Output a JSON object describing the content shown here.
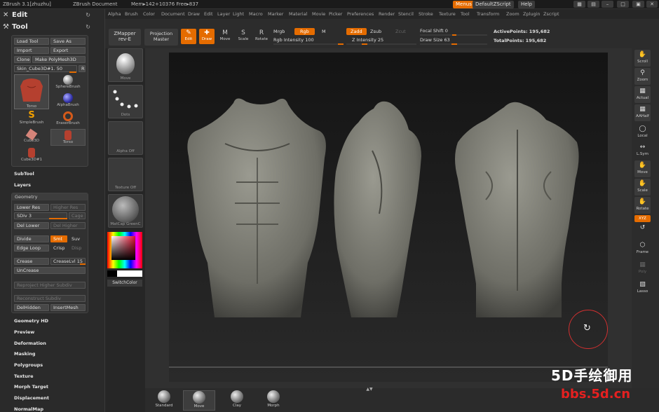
{
  "titlebar": {
    "app": "ZBrush 3.1[zhuzhu]",
    "doc": "ZBrush Document",
    "mem": "Mem▸142+10376 Free▸837",
    "menus": "Menus",
    "script": "DefaultZScript",
    "help": "Help"
  },
  "menubar": [
    "Alpha",
    "Brush",
    "Color",
    "Document",
    "Draw",
    "Edit",
    "Layer",
    "Light",
    "Macro",
    "Marker",
    "Material",
    "Movie",
    "Picker",
    "Preferences",
    "Render",
    "Stencil",
    "Stroke",
    "Texture",
    "Tool",
    "Transform",
    "Zoom",
    "Zplugin",
    "Zscript"
  ],
  "left": {
    "edit": "Edit",
    "tool": "Tool",
    "load_tool": "Load Tool",
    "save_as": "Save As",
    "import": "Import",
    "export": "Export",
    "clone": "Clone",
    "make_polymesh": "Make PolyMesh3D",
    "skin_slider": "Skin_Cube3D#1. 50",
    "r": "R",
    "thumbs": [
      "Torso",
      "SphereBrush",
      "AlphaBrush",
      "SimpleBrush",
      "EraserBrush",
      "Cube3D",
      "Torso",
      "Cube3D#1"
    ],
    "subtool": "SubTool",
    "layers": "Layers",
    "geometry": "Geometry",
    "lower_res": "Lower Res",
    "higher_res": "Higher Res",
    "sdiv": "SDiv 3",
    "cage": "Cage",
    "del_lower": "Del Lower",
    "del_higher": "Del Higher",
    "divide": "Divide",
    "smt": "Smt",
    "suv": "Suv",
    "edge_loop": "Edge Loop",
    "crisp": "Crisp",
    "disp": "Disp",
    "crease": "Crease",
    "creaselvl": "CreaseLvl 15",
    "uncrease": "UnCrease",
    "reproject": "Reproject Higher Subdiv",
    "reconstruct": "Reconstruct Subdiv",
    "delhidden": "DelHidden",
    "insertmesh": "InsertMesh",
    "sections": [
      "Geometry HD",
      "Preview",
      "Deformation",
      "Masking",
      "Polygroups",
      "Texture",
      "Morph Target",
      "Displacement",
      "NormalMap"
    ]
  },
  "toolbar": {
    "zmapper": "ZMapper",
    "zmapper2": "rev-E",
    "projection": "Projection",
    "projection2": "Master",
    "edit": "Edit",
    "draw": "Draw",
    "move": "Move",
    "scale": "Scale",
    "rotate": "Rotate",
    "mrgb": "Mrgb",
    "rgb": "Rgb",
    "m": "M",
    "rgb_intensity": "Rgb Intensity 100",
    "zadd": "Zadd",
    "zsub": "Zsub",
    "zcut": "Zcut",
    "z_intensity": "Z Intensity 25",
    "focal_shift": "Focal Shift 0",
    "draw_size": "Draw Size 63",
    "active_points": "ActivePoints: 195,682",
    "total_points": "TotalPoints: 195,682"
  },
  "shelf": [
    "Move",
    "Dots",
    "Alpha Off",
    "Texture Off",
    "MatCap GreenC",
    "SwitchColor"
  ],
  "right": [
    "Scroll",
    "Zoom",
    "Actual",
    "AAHalf",
    "Local",
    "L.Sym",
    "Move",
    "Scale",
    "Rotate",
    "XYZ",
    "",
    "Frame",
    "Poly",
    "Lasso"
  ],
  "bottom": [
    "Standard",
    "Move",
    "Clay",
    "Morph"
  ],
  "watermark": {
    "line1": "5D手绘御用",
    "line2": "bbs.5d.cn"
  },
  "colors": {
    "accent": "#e56c00",
    "panel": "#2a2a2a"
  }
}
